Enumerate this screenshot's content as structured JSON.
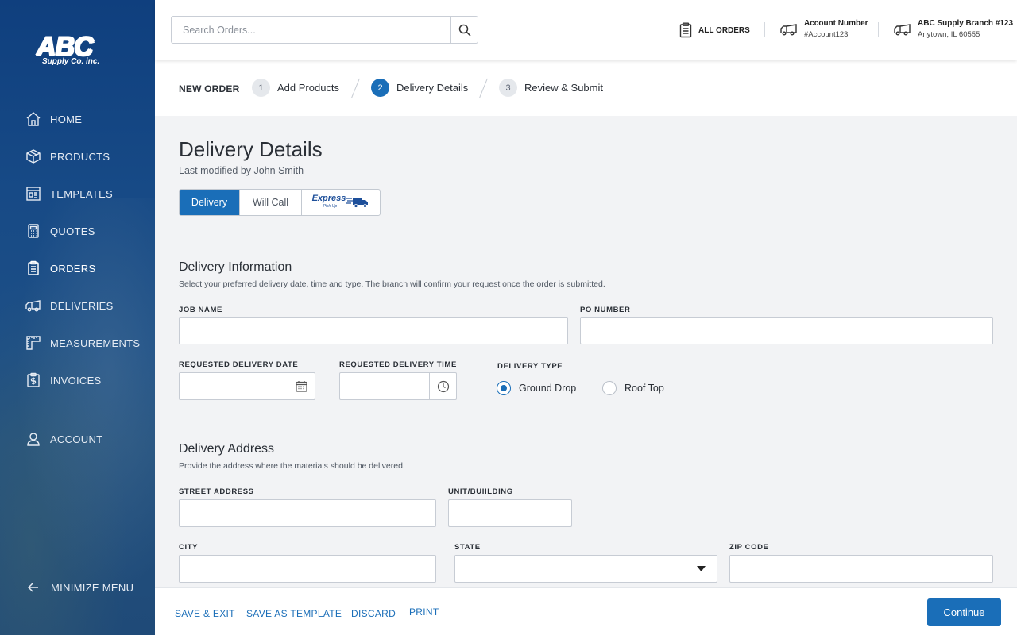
{
  "brand": {
    "logo_text": "ABC",
    "logo_sub": "Supply Co. inc."
  },
  "sidebar": {
    "items": [
      {
        "label": "HOME",
        "icon": "home-icon"
      },
      {
        "label": "PRODUCTS",
        "icon": "box-icon"
      },
      {
        "label": "TEMPLATES",
        "icon": "template-icon"
      },
      {
        "label": "QUOTES",
        "icon": "calculator-icon"
      },
      {
        "label": "ORDERS",
        "icon": "clipboard-icon",
        "active": true
      },
      {
        "label": "DELIVERIES",
        "icon": "truck-icon"
      },
      {
        "label": "MEASUREMENTS",
        "icon": "measure-icon"
      },
      {
        "label": "INVOICES",
        "icon": "invoice-icon"
      },
      {
        "label": "ACCOUNT",
        "icon": "user-icon"
      }
    ],
    "minimize_label": "MINIMIZE MENU"
  },
  "header": {
    "search_placeholder": "Search Orders...",
    "all_orders": "ALL ORDERS",
    "account_title": "Account Number",
    "account_value": "#Account123",
    "branch_title": "ABC Supply Branch #123",
    "branch_location": "Anytown, IL 60555"
  },
  "stepper": {
    "title": "NEW ORDER",
    "steps": [
      {
        "num": "1",
        "label": "Add Products"
      },
      {
        "num": "2",
        "label": "Delivery Details",
        "current": true
      },
      {
        "num": "3",
        "label": "Review & Submit"
      }
    ]
  },
  "main": {
    "title": "Delivery Details",
    "modified": "Last modified by John Smith",
    "methods": [
      "Delivery",
      "Will Call"
    ],
    "express_label": "Express",
    "express_sub": "Pick-Up",
    "delivery_info": {
      "title": "Delivery Information",
      "desc": "Select your preferred delivery date, time and type. The branch will confirm your request once the order is submitted.",
      "job_name": "JOB NAME",
      "po_number": "PO NUMBER",
      "req_date": "REQUESTED DELIVERY DATE",
      "req_time": "REQUESTED DELIVERY TIME",
      "delivery_type": "DELIVERY TYPE",
      "type_options": [
        "Ground Drop",
        "Roof Top"
      ]
    },
    "delivery_address": {
      "title": "Delivery Address",
      "desc": "Provide the address where the materials should be delivered.",
      "street": "STREET ADDRESS",
      "unit": "UNIT/BUIILDING",
      "city": "CITY",
      "state": "STATE",
      "zip": "ZIP CODE"
    }
  },
  "footer": {
    "save_exit": "SAVE & EXIT",
    "save_template": "SAVE AS TEMPLATE",
    "discard": "DISCARD",
    "print": "PRINT",
    "continue": "Continue"
  },
  "colors": {
    "primary": "#1a6eb8",
    "sidebar": "#174a86",
    "logo_red": "#d8222a"
  }
}
